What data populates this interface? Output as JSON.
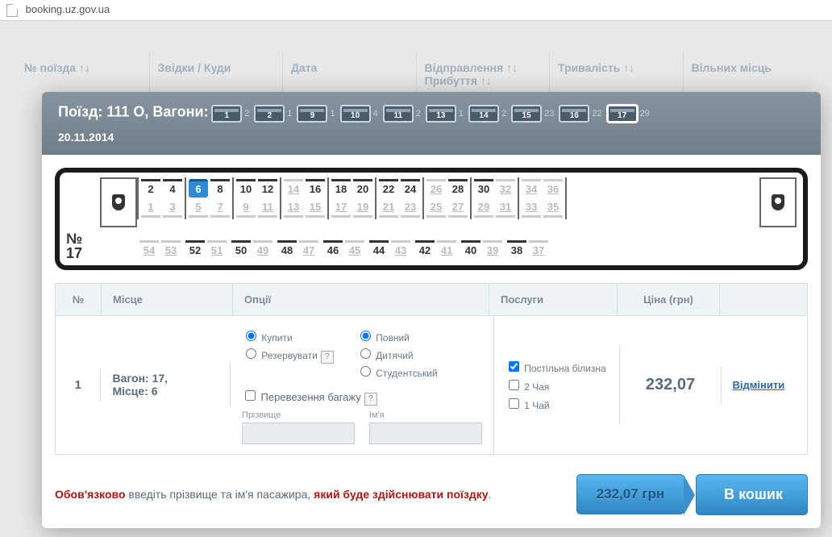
{
  "url": "booking.uz.gov.ua",
  "background_columns": [
    "№ поїзда ↑↓",
    "Звідки / Куди",
    "Дата",
    "Відправлення ↑↓ Прибуття ↑↓",
    "Тривалість ↑↓",
    "Вільних місць"
  ],
  "train_label": "Поїзд: 111 О, Вагони:",
  "train_date": "20.11.2014",
  "wagons": [
    {
      "num": "1",
      "free": "2"
    },
    {
      "num": "2",
      "free": "1"
    },
    {
      "num": "9",
      "free": "1"
    },
    {
      "num": "10",
      "free": "4"
    },
    {
      "num": "11",
      "free": "2"
    },
    {
      "num": "13",
      "free": "1"
    },
    {
      "num": "14",
      "free": "2"
    },
    {
      "num": "15",
      "free": "23"
    },
    {
      "num": "16",
      "free": "22"
    },
    {
      "num": "17",
      "free": "29",
      "selected": true
    }
  ],
  "coach_title_no": "№",
  "coach_title_num": "17",
  "upper_row1": [
    {
      "n": "2",
      "t": false
    },
    {
      "n": "4",
      "t": false
    },
    {
      "n": "6",
      "t": false,
      "sel": true
    },
    {
      "n": "8",
      "t": false
    },
    {
      "n": "10",
      "t": false
    },
    {
      "n": "12",
      "t": false
    },
    {
      "n": "14",
      "t": true
    },
    {
      "n": "16",
      "t": false
    },
    {
      "n": "18",
      "t": false
    },
    {
      "n": "20",
      "t": false
    },
    {
      "n": "22",
      "t": false
    },
    {
      "n": "24",
      "t": false
    },
    {
      "n": "26",
      "t": true
    },
    {
      "n": "28",
      "t": false
    },
    {
      "n": "30",
      "t": false
    },
    {
      "n": "32",
      "t": true
    },
    {
      "n": "34",
      "t": true
    },
    {
      "n": "36",
      "t": true
    }
  ],
  "upper_row2": [
    {
      "n": "1",
      "t": true
    },
    {
      "n": "3",
      "t": true
    },
    {
      "n": "5",
      "t": true
    },
    {
      "n": "7",
      "t": true
    },
    {
      "n": "9",
      "t": true
    },
    {
      "n": "11",
      "t": true
    },
    {
      "n": "13",
      "t": true
    },
    {
      "n": "15",
      "t": true
    },
    {
      "n": "17",
      "t": true
    },
    {
      "n": "19",
      "t": true
    },
    {
      "n": "21",
      "t": true
    },
    {
      "n": "23",
      "t": true
    },
    {
      "n": "25",
      "t": true
    },
    {
      "n": "27",
      "t": true
    },
    {
      "n": "29",
      "t": true
    },
    {
      "n": "31",
      "t": true
    },
    {
      "n": "33",
      "t": true
    },
    {
      "n": "35",
      "t": true
    }
  ],
  "side_row": [
    {
      "n": "54",
      "t": true
    },
    {
      "n": "53",
      "t": true
    },
    {
      "n": "52",
      "t": false
    },
    {
      "n": "51",
      "t": true
    },
    {
      "n": "50",
      "t": false
    },
    {
      "n": "49",
      "t": true
    },
    {
      "n": "48",
      "t": false
    },
    {
      "n": "47",
      "t": true
    },
    {
      "n": "46",
      "t": false
    },
    {
      "n": "45",
      "t": true
    },
    {
      "n": "44",
      "t": false
    },
    {
      "n": "43",
      "t": true
    },
    {
      "n": "42",
      "t": false
    },
    {
      "n": "41",
      "t": true
    },
    {
      "n": "40",
      "t": false
    },
    {
      "n": "39",
      "t": true
    },
    {
      "n": "38",
      "t": false
    },
    {
      "n": "37",
      "t": true
    }
  ],
  "table_headers": {
    "no": "№",
    "seat": "Місце",
    "opts": "Опції",
    "services": "Послуги",
    "price": "Ціна (грн)"
  },
  "booking_row": {
    "index": "1",
    "seat_line1": "Вагон: 17,",
    "seat_line2": "Місце: 6",
    "action_buy": "Купити",
    "action_reserve": "Резервувати",
    "fare_full": "Повний",
    "fare_child": "Дитячий",
    "fare_student": "Студентський",
    "baggage": "Перевезення багажу",
    "surname_lbl": "Прізвище",
    "name_lbl": "Ім'я",
    "srv_bed": "Постільна білизна",
    "srv_tea2": "2 Чая",
    "srv_tea1": "1 Чай",
    "price": "232,07",
    "cancel": "Відмінити"
  },
  "warning_req1": "Обов'язково",
  "warning_mid": " введіть прізвище та ім'я пасажира, ",
  "warning_req2": "який буде здійснювати поїздку",
  "warning_dot": ".",
  "total": "232,07 грн",
  "cart_btn": "В кошик"
}
